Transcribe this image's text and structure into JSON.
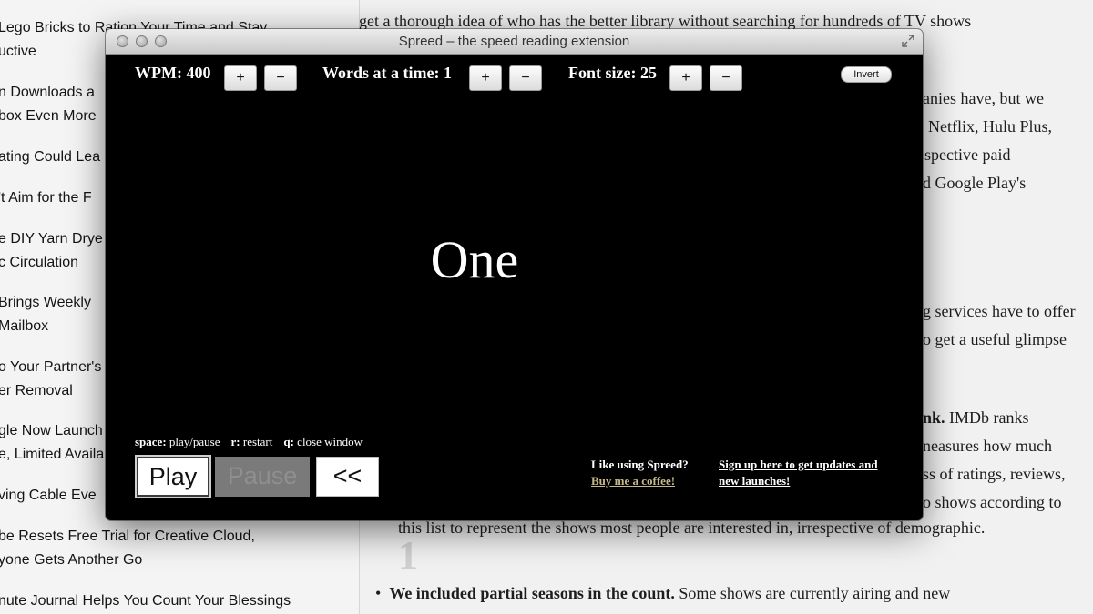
{
  "sidebar": {
    "headlines": [
      {
        "lines": [
          "Lego Bricks to Ration Your Time and Stay",
          "uctive"
        ]
      },
      {
        "lines": [
          "n Downloads a",
          "box Even More"
        ]
      },
      {
        "lines": [
          "ating Could Lea"
        ]
      },
      {
        "lines": [
          "'t Aim for the F"
        ]
      },
      {
        "lines": [
          "e DIY Yarn Drye",
          "c Circulation"
        ]
      },
      {
        "lines": [
          "Brings Weekly",
          "Mailbox"
        ]
      },
      {
        "lines": [
          "o Your Partner's",
          "er Removal"
        ]
      },
      {
        "lines": [
          "gle Now Launch",
          "e, Limited Availa"
        ]
      },
      {
        "lines": [
          "ving Cable Eve"
        ]
      },
      {
        "lines": [
          "be Resets Free Trial for Creative Cloud,",
          "yone Gets Another Go"
        ]
      },
      {
        "lines": [
          "nute Journal Helps You Count Your Blessings"
        ]
      }
    ]
  },
  "article": {
    "lines": [
      "get a thorough idea of who has the better library without searching for hundreds of TV shows",
      "anies have, but we",
      "Netflix, Hulu Plus,",
      "spective paid",
      "d Google Play's",
      "g services have to offer",
      "o get a useful glimpse",
      "IMDb ranks",
      "neasures how much",
      "ss of ratings, reviews,",
      "o shows according to",
      "this list to represent the shows most people are interested in, irrespective of demographic."
    ],
    "bold_fragment": "nk.",
    "bullet_bold": "We included partial seasons in the count.",
    "bullet_rest": "Some shows are currently airing and new",
    "big_digit": "1"
  },
  "window": {
    "title": "Spreed – the speed reading extension",
    "wpm_label": "WPM: 400",
    "words_label": "Words at a time: 1",
    "font_label": "Font size: 25",
    "plus": "+",
    "minus": "−",
    "invert": "Invert",
    "current_word": "One",
    "shortcuts": {
      "space_key": "space:",
      "space_desc": "play/pause",
      "r_key": "r:",
      "r_desc": "restart",
      "q_key": "q:",
      "q_desc": "close window"
    },
    "play": "Play",
    "pause": "Pause",
    "rewind": "<<",
    "promo_question": "Like using Spreed?",
    "promo_coffee": "Buy me a coffee!",
    "promo_signup_1": "Sign up here to get updates and",
    "promo_signup_2": "new launches!"
  },
  "colors": {
    "window_bg": "#000000",
    "coffee_link": "#c8b98a",
    "pause_disabled": "#7a7a7a"
  }
}
